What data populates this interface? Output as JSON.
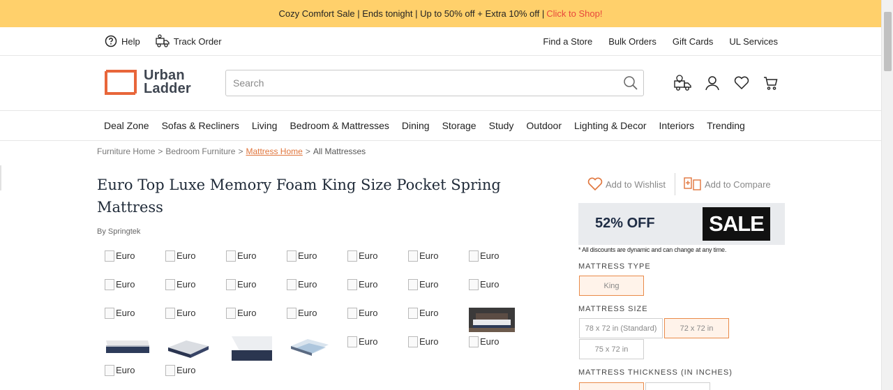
{
  "promo": {
    "text": "Cozy Comfort Sale | Ends tonight | Up to 50% off + Extra 10% off |",
    "cta": "Click to Shop!"
  },
  "utility": {
    "help": "Help",
    "track_order": "Track Order",
    "links": [
      "Find a Store",
      "Bulk Orders",
      "Gift Cards",
      "UL Services"
    ]
  },
  "logo": {
    "line1": "Urban",
    "line2": "Ladder"
  },
  "search": {
    "placeholder": "Search"
  },
  "nav": [
    "Deal Zone",
    "Sofas & Recliners",
    "Living",
    "Bedroom & Mattresses",
    "Dining",
    "Storage",
    "Study",
    "Outdoor",
    "Lighting & Decor",
    "Interiors",
    "Trending"
  ],
  "breadcrumb": {
    "items": [
      "Furniture Home",
      "Bedroom Furniture",
      "Mattress Home",
      "All Mattresses"
    ],
    "sep": ">"
  },
  "product": {
    "title": "Euro Top Luxe Memory Foam King Size Pocket Spring Mattress",
    "brand": "By Springtek"
  },
  "gallery": {
    "alt_text": "Euro"
  },
  "actions": {
    "wishlist": "Add to Wishlist",
    "compare": "Add to Compare"
  },
  "sale": {
    "percent": "52% OFF",
    "tag": "SALE",
    "disclaimer": "* All discounts are dynamic and can change at any time."
  },
  "options": {
    "type_label": "MATTRESS TYPE",
    "type_values": [
      "King"
    ],
    "size_label": "MATTRESS SIZE",
    "size_values": [
      "78 x 72 in (Standard)",
      "72 x 72 in",
      "75 x 72 in"
    ],
    "thickness_label": "MATTRESS THICKNESS (IN INCHES)"
  },
  "colors": {
    "promo_bg": "#ffd06b",
    "accent": "#e0753c",
    "cta": "#e8473b"
  }
}
